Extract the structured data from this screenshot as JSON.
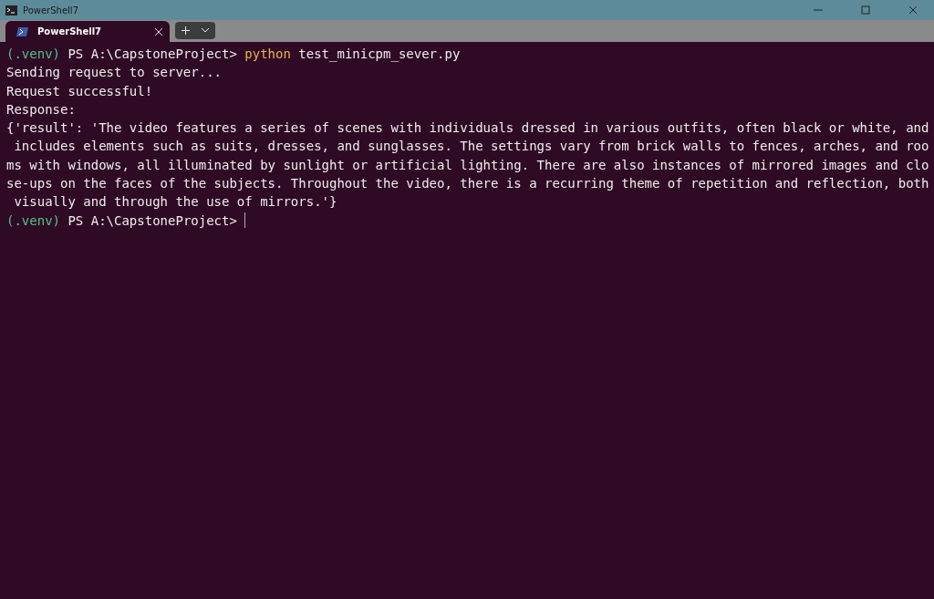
{
  "window": {
    "title": "PowerShell7"
  },
  "tabs": [
    {
      "label": "PowerShell7",
      "selected": true
    }
  ],
  "terminal": {
    "lines": [
      [
        {
          "kind": "venv",
          "text": "(.venv)"
        },
        {
          "kind": "plain",
          "text": " PS A:\\CapstoneProject> "
        },
        {
          "kind": "command",
          "text": "python"
        },
        {
          "kind": "plain",
          "text": " test_minicpm_sever.py"
        }
      ],
      [
        {
          "kind": "plain",
          "text": "Sending request to server..."
        }
      ],
      [
        {
          "kind": "plain",
          "text": "Request successful!"
        }
      ],
      [
        {
          "kind": "plain",
          "text": "Response:"
        }
      ],
      [
        {
          "kind": "plain",
          "text": "{'result': 'The video features a series of scenes with individuals dressed in various outfits, often black or white, and"
        }
      ],
      [
        {
          "kind": "plain",
          "text": " includes elements such as suits, dresses, and sunglasses. The settings vary from brick walls to fences, arches, and roo"
        }
      ],
      [
        {
          "kind": "plain",
          "text": "ms with windows, all illuminated by sunlight or artificial lighting. There are also instances of mirrored images and clo"
        }
      ],
      [
        {
          "kind": "plain",
          "text": "se-ups on the faces of the subjects. Throughout the video, there is a recurring theme of repetition and reflection, both"
        }
      ],
      [
        {
          "kind": "plain",
          "text": " visually and through the use of mirrors.'}"
        }
      ],
      [
        {
          "kind": "venv",
          "text": "(.venv)"
        },
        {
          "kind": "plain",
          "text": " PS A:\\CapstoneProject> "
        }
      ]
    ]
  }
}
